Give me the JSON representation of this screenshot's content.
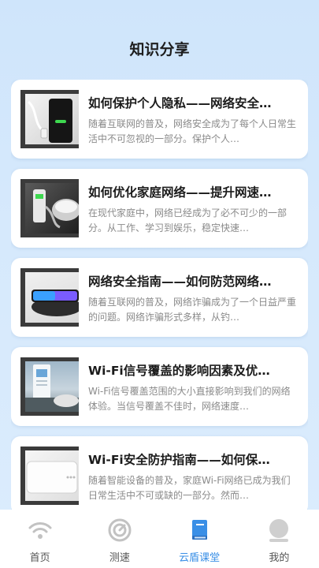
{
  "header": {
    "title": "知识分享"
  },
  "articles": [
    {
      "title": "如何保护个人隐私——网络安全…",
      "desc": "随着互联网的普及，网络安全成为了每个人日常生活中不可忽视的一部分。保护个人…",
      "thumb": "phone-charging-image"
    },
    {
      "title": "如何优化家庭网络——提升网速…",
      "desc": "在现代家庭中，网络已经成为了必不可少的一部分。从工作、学习到娱乐，稳定快速…",
      "thumb": "ev-charger-image"
    },
    {
      "title": "网络安全指南——如何防范网络…",
      "desc": "随着互联网的普及，网络诈骗成为了一个日益严重的问题。网络诈骗形式多样，从钓…",
      "thumb": "wireless-charger-image"
    },
    {
      "title": "Wi-Fi信号覆盖的影响因素及优…",
      "desc": "Wi-Fi信号覆盖范围的大小直接影响到我们的网络体验。当信号覆盖不佳时，网络速度…",
      "thumb": "charging-station-image"
    },
    {
      "title": "Wi-Fi安全防护指南——如何保…",
      "desc": "随着智能设备的普及，家庭Wi-Fi网络已成为我们日常生活中不可或缺的一部分。然而…",
      "thumb": "power-bank-image"
    }
  ],
  "tabbar": {
    "items": [
      {
        "label": "首页",
        "icon": "wifi-icon",
        "active": false
      },
      {
        "label": "测速",
        "icon": "speedometer-icon",
        "active": false
      },
      {
        "label": "云盾课堂",
        "icon": "book-icon",
        "active": true
      },
      {
        "label": "我的",
        "icon": "profile-icon",
        "active": false
      }
    ],
    "active_color": "#3a8fe6",
    "inactive_color": "#555555"
  }
}
